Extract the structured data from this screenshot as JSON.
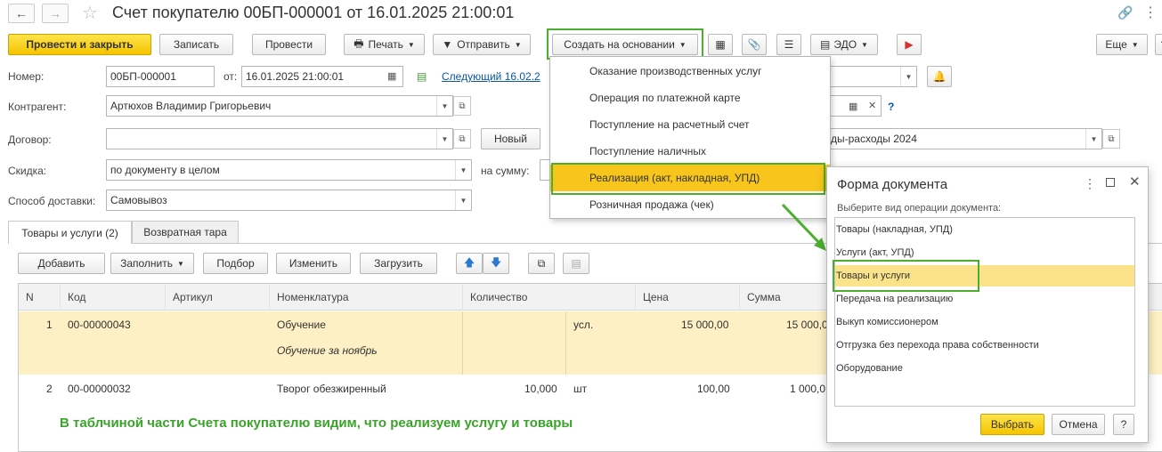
{
  "window": {
    "title": "Счет покупателю 00БП-000001 от 16.01.2025 21:00:01"
  },
  "toolbar": {
    "post_close": "Провести и закрыть",
    "save": "Записать",
    "post": "Провести",
    "print": "Печать",
    "send": "Отправить",
    "create_based": "Создать на основании",
    "edo": "ЭДО",
    "more": "Еще",
    "help": "?"
  },
  "fields": {
    "number_label": "Номер:",
    "number_value": "00БП-000001",
    "date_label": "от:",
    "date_value": "16.01.2025 21:00:01",
    "next_link": "Следующий 16.02.2",
    "contractor_label": "Контрагент:",
    "contractor_value": "Артюхов Владимир Григорьевич",
    "contract_label": "Договор:",
    "new_button": "Новый",
    "expense_value": "ды-расходы 2024",
    "discount_label": "Скидка:",
    "discount_value": "по документу в целом",
    "sum_label": "на сумму:",
    "delivery_label": "Способ доставки:",
    "delivery_value": "Самовывоз",
    "question": "?"
  },
  "menu": {
    "items": [
      "Оказание производственных услуг",
      "Операция по платежной карте",
      "Поступление на расчетный счет",
      "Поступление наличных",
      "Реализация (акт, накладная, УПД)",
      "Розничная продажа (чек)"
    ],
    "highlighted_index": 4
  },
  "tabs": [
    "Товары и услуги (2)",
    "Возвратная тара"
  ],
  "table_toolbar": {
    "add": "Добавить",
    "fill": "Заполнить",
    "select": "Подбор",
    "edit": "Изменить",
    "load": "Загрузить"
  },
  "grid": {
    "headers": [
      "N",
      "Код",
      "Артикул",
      "Номенклатура",
      "Количество",
      "Цена",
      "Сумма"
    ],
    "rows": [
      {
        "n": "1",
        "code": "00-00000043",
        "name": "Обучение",
        "desc": "Обучение за ноябрь",
        "qty": "",
        "unit": "усл.",
        "price": "15 000,00",
        "sum": "15 000,0"
      },
      {
        "n": "2",
        "code": "00-00000032",
        "name": "Творог обезжиренный",
        "desc": "",
        "qty": "10,000",
        "unit": "шт",
        "price": "100,00",
        "sum": "1 000,0"
      }
    ]
  },
  "annotation": "В таблчиной части Счета покупателю видим, что реализуем услугу и товары",
  "dialog": {
    "title": "Форма документа",
    "prompt": "Выберите вид операции документа:",
    "options": [
      "Товары (накладная, УПД)",
      "Услуги (акт, УПД)",
      "Товары и услуги",
      "Передача на реализацию",
      "Выкуп комиссионером",
      "Отгрузка без перехода права собственности",
      "Оборудование"
    ],
    "selected_index": 2,
    "ok": "Выбрать",
    "cancel": "Отмена",
    "help": "?"
  },
  "colors": {
    "accent_yellow": "#f5c400",
    "highlight_green": "#4cae2f",
    "row_selected": "#fdf0c4",
    "link_blue": "#0b57a8",
    "annotation_green": "#3aa32a"
  }
}
